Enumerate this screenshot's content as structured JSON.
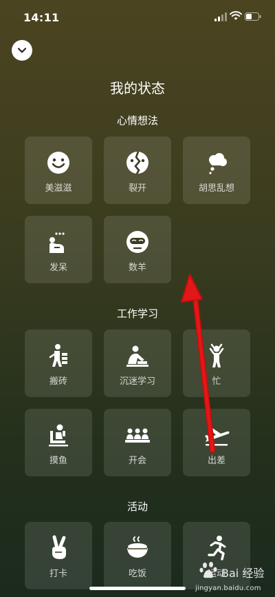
{
  "status_bar": {
    "time": "14:11"
  },
  "page": {
    "title": "我的状态"
  },
  "sections": [
    {
      "title": "心情想法",
      "items": [
        {
          "label": "美滋滋",
          "icon": "smile-icon"
        },
        {
          "label": "裂开",
          "icon": "cracked-face-icon"
        },
        {
          "label": "胡思乱想",
          "icon": "thought-cloud-icon"
        },
        {
          "label": "发呆",
          "icon": "daze-icon"
        },
        {
          "label": "数羊",
          "icon": "sleep-mask-icon"
        }
      ]
    },
    {
      "title": "工作学习",
      "items": [
        {
          "label": "搬砖",
          "icon": "brick-carry-icon"
        },
        {
          "label": "沉迷学习",
          "icon": "study-icon"
        },
        {
          "label": "忙",
          "icon": "busy-icon"
        },
        {
          "label": "摸鱼",
          "icon": "slack-off-icon"
        },
        {
          "label": "开会",
          "icon": "meeting-icon"
        },
        {
          "label": "出差",
          "icon": "airplane-icon"
        }
      ]
    },
    {
      "title": "活动",
      "items": [
        {
          "label": "打卡",
          "icon": "victory-hand-icon"
        },
        {
          "label": "吃饭",
          "icon": "rice-bowl-icon"
        },
        {
          "label": "运动",
          "icon": "running-icon"
        }
      ]
    }
  ],
  "watermark": {
    "text": "Bai 经验",
    "url": "jingyan.baidu.com"
  },
  "colors": {
    "arrow": "#e01414",
    "tile_bg": "rgba(255,255,255,0.11)"
  }
}
